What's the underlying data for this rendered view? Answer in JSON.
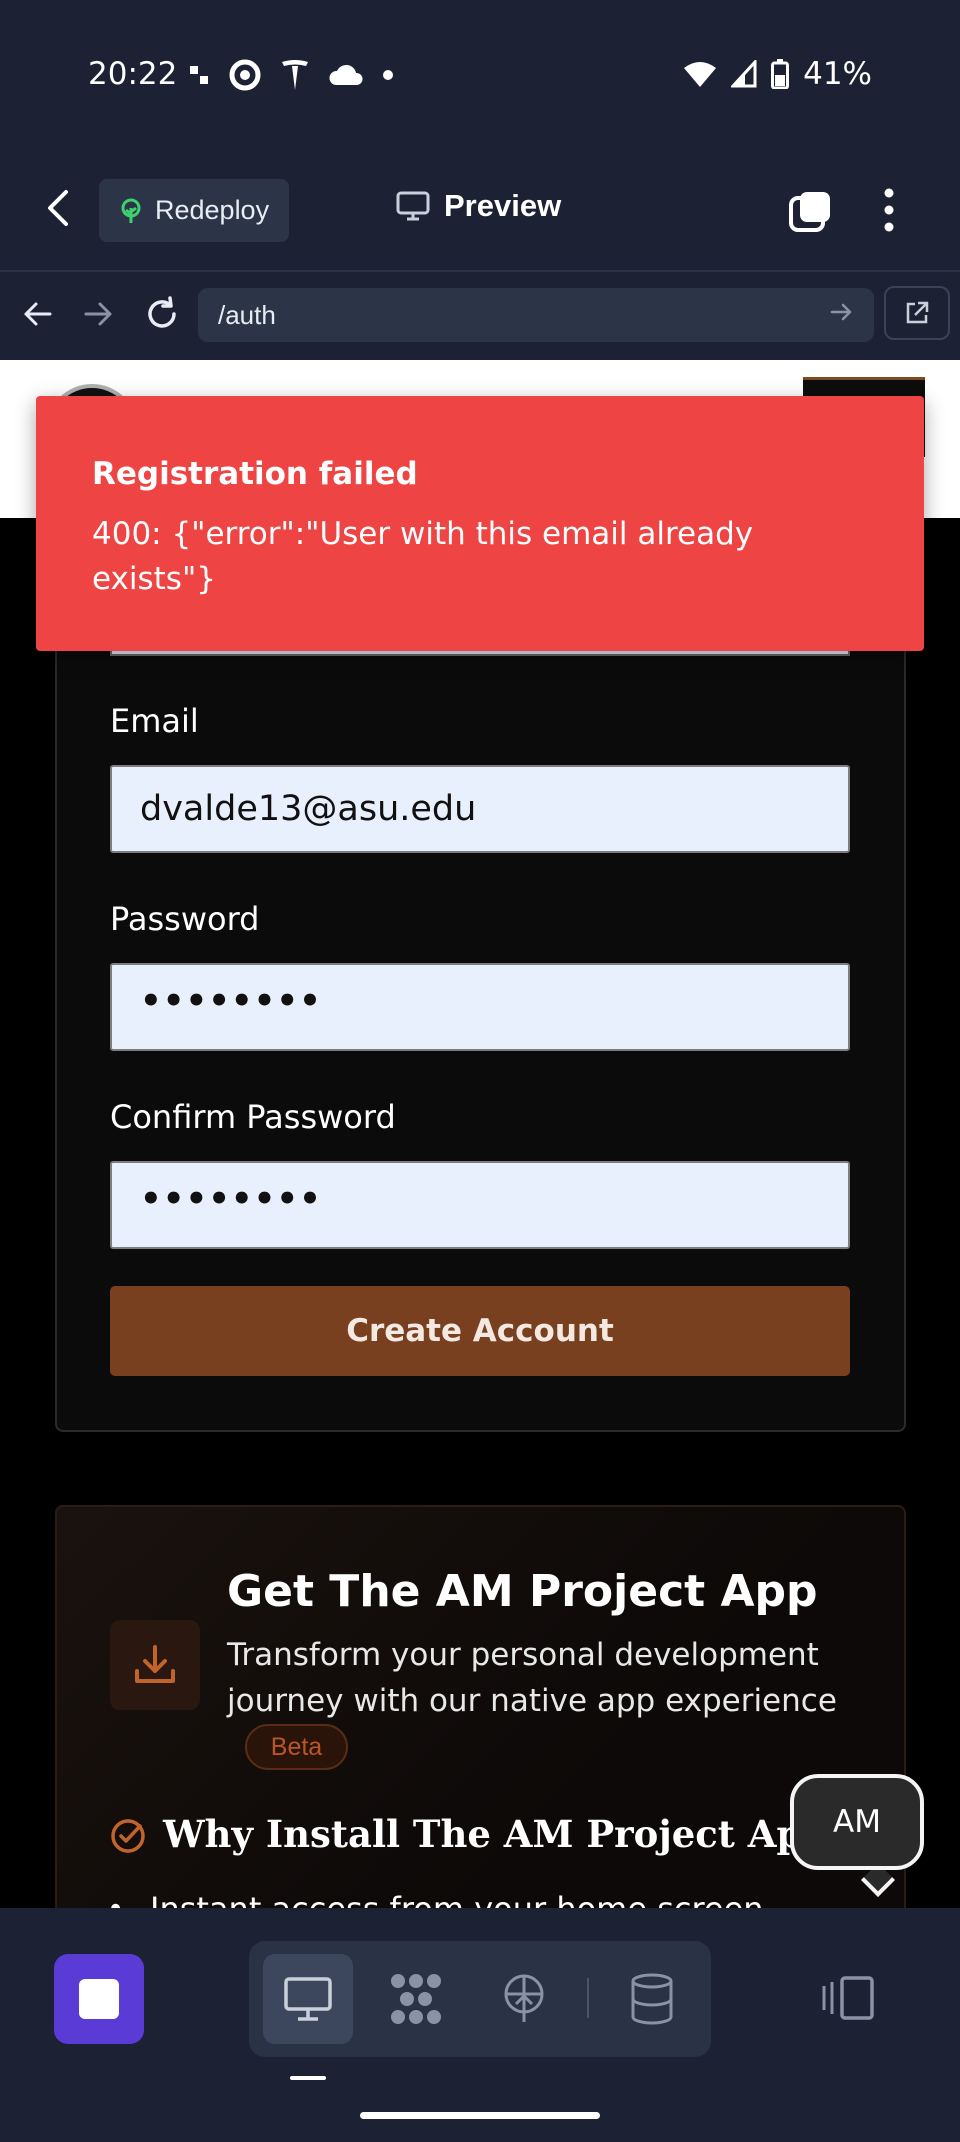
{
  "status_bar": {
    "time": "20:22",
    "battery": "41%"
  },
  "app_header": {
    "redeploy_label": "Redeploy",
    "preview_label": "Preview"
  },
  "url_bar": {
    "url": "/auth"
  },
  "toast": {
    "title": "Registration failed",
    "message": "400: {\"error\":\"User with this email already exists\"}"
  },
  "form": {
    "email_label": "Email",
    "email_value": "dvalde13@asu.edu",
    "password_label": "Password",
    "password_value": "••••••••",
    "confirm_label": "Confirm Password",
    "confirm_value": "••••••••",
    "submit_label": "Create Account"
  },
  "promo": {
    "title": "Get The AM Project App",
    "description": "Transform your personal development journey with our native app experience",
    "badge": "Beta",
    "why_title": "Why Install The AM Project App?",
    "first_bullet": "Instant access from your home screen"
  },
  "assistant_bubble": {
    "label": "AM"
  },
  "colors": {
    "toast_bg": "#ef4444",
    "submit_bg": "#78401f",
    "stop_btn": "#5b3bd6",
    "chrome_bg": "#1c2233"
  },
  "icons": [
    "back-icon",
    "tree-icon",
    "monitor-icon",
    "copy-icon",
    "kebab-icon",
    "arrow-left-icon",
    "arrow-right-icon",
    "refresh-icon",
    "external-link-icon",
    "download-icon",
    "check-circle-icon",
    "desktop-icon",
    "grid-icon",
    "deploy-icon",
    "database-icon",
    "panels-icon"
  ]
}
